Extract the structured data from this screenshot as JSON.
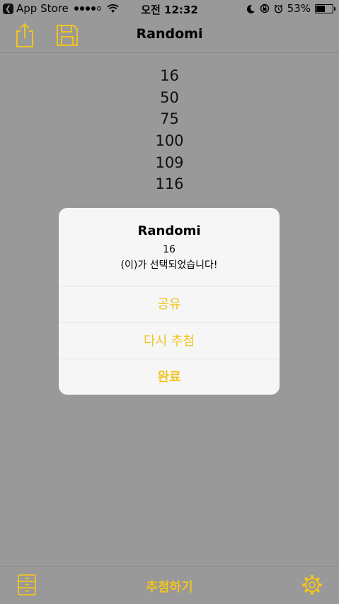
{
  "colors": {
    "accent": "#f0c420",
    "dimmed_background": "#999999",
    "alert_background": "#f6f6f6"
  },
  "status_bar": {
    "back_label": "App Store",
    "time": "오전 12:32",
    "battery_percent": "53%",
    "battery_level": 0.53,
    "signal_bars": 4,
    "icons": [
      "back-chevron-icon",
      "signal-dots-icon",
      "wifi-icon",
      "moon-icon",
      "rotation-lock-icon",
      "alarm-icon",
      "battery-icon"
    ]
  },
  "nav": {
    "title": "Randomi",
    "icons": [
      "share-icon",
      "save-icon"
    ]
  },
  "numbers": [
    "16",
    "50",
    "75",
    "100",
    "109",
    "116"
  ],
  "alert": {
    "title": "Randomi",
    "message_value": "16",
    "message_text": "(이)가 선택되었습니다!",
    "buttons": {
      "share": "공유",
      "again": "다시 추첨",
      "done": "완료"
    }
  },
  "tab_bar": {
    "action": "추첨하기",
    "icons": [
      "cabinet-icon",
      "settings-icon"
    ]
  }
}
